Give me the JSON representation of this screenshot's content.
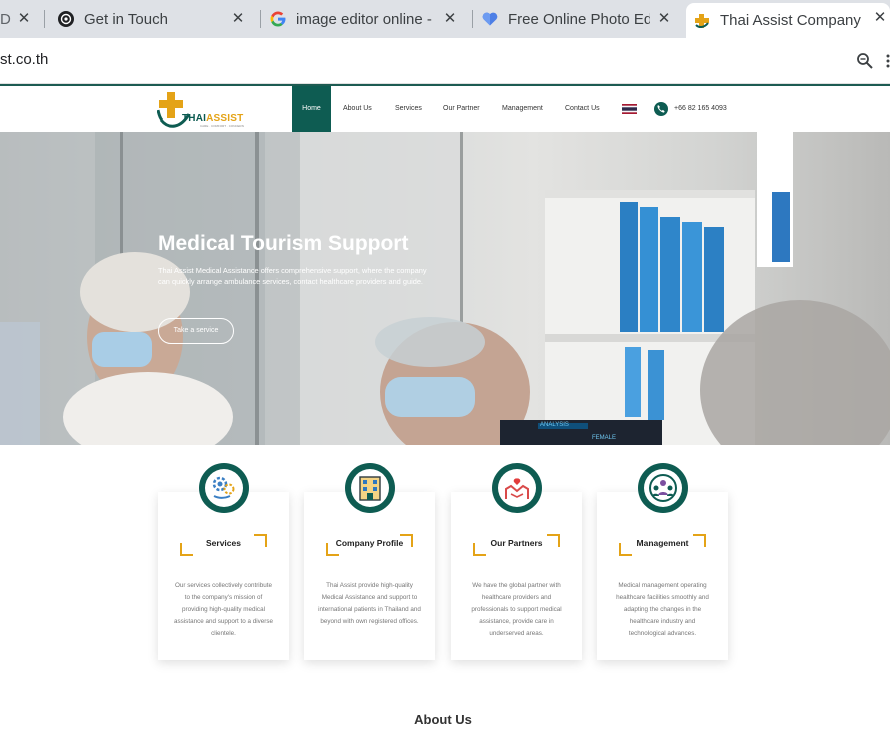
{
  "browser": {
    "tabs": [
      {
        "title": "D",
        "favicon": "tab-edge-icon"
      },
      {
        "title": "Get in Touch",
        "favicon": "openai-icon"
      },
      {
        "title": "image editor online -",
        "favicon": "google-icon"
      },
      {
        "title": "Free Online Photo Ed",
        "favicon": "heart-icon"
      },
      {
        "title": "Thai Assist Company",
        "favicon": "thai-assist-icon",
        "active": true
      }
    ],
    "url": "st.co.th"
  },
  "header": {
    "logo_text_1": "THAI",
    "logo_text_2": "ASSIST",
    "logo_sub": "CARE · COMFORT · CONCERN",
    "nav": [
      "Home",
      "About Us",
      "Services",
      "Our Partner",
      "Management",
      "Contact Us"
    ],
    "phone": "+66 82 165 4093"
  },
  "hero": {
    "title": "Medical Tourism Support",
    "description": "Thai Assist Medical Assistance offers comprehensive support, where the company can quickly arrange ambulance services, contact healthcare providers and guide.",
    "button": "Take a service",
    "screen_labels": [
      "ANALYSIS",
      "FEMALE"
    ]
  },
  "cards": [
    {
      "title": "Services",
      "icon": "gears-hand-icon",
      "description": "Our services collectively contribute to the company's mission of providing high-quality medical assistance and support to a diverse clientele."
    },
    {
      "title": "Company Profile",
      "icon": "building-icon",
      "description": "Thai Assist provide high-quality Medical Assistance and support to international patients in Thailand and beyond with own registered offices."
    },
    {
      "title": "Our Partners",
      "icon": "handshake-heart-icon",
      "description": "We have the global partner with healthcare providers and professionals to support medical assistance, provide care in underserved areas."
    },
    {
      "title": "Management",
      "icon": "team-icon",
      "description": "Medical management operating healthcare facilities smoothly and adapting the changes in the healthcare industry and technological advances."
    }
  ],
  "sections": {
    "about_heading": "About Us"
  },
  "colors": {
    "brand_green": "#0e5c52",
    "accent_gold": "#e4a317"
  }
}
